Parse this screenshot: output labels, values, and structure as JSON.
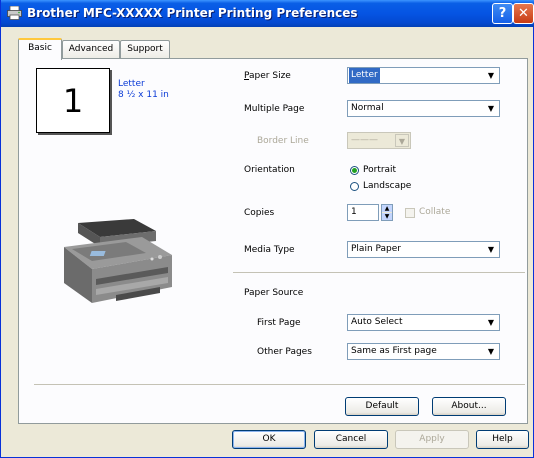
{
  "window": {
    "title": "Brother MFC-XXXXX Printer Printing Preferences",
    "help_glyph": "?",
    "close_glyph": "✕",
    "icon": "printer-icon"
  },
  "tabs": [
    {
      "label": "Basic",
      "active": true
    },
    {
      "label": "Advanced",
      "active": false
    },
    {
      "label": "Support",
      "active": false
    }
  ],
  "preview": {
    "page_number": "1",
    "paper_name": "Letter",
    "paper_dims": "8 ½ x 11 in",
    "device_image": "printer-device-illustration"
  },
  "form": {
    "paper_size": {
      "label": "Paper Size",
      "value": "Letter"
    },
    "multiple_page": {
      "label": "Multiple Page",
      "value": "Normal"
    },
    "border_line": {
      "label": "Border Line",
      "value": "———",
      "enabled": false
    },
    "orientation": {
      "label": "Orientation",
      "options": [
        "Portrait",
        "Landscape"
      ],
      "selected": "Portrait"
    },
    "copies": {
      "label": "Copies",
      "value": "1",
      "collate_label": "Collate",
      "collate_checked": false,
      "collate_enabled": false
    },
    "media_type": {
      "label": "Media Type",
      "value": "Plain Paper"
    },
    "paper_source": {
      "label": "Paper Source",
      "first_page": {
        "label": "First Page",
        "value": "Auto Select"
      },
      "other_pages": {
        "label": "Other Pages",
        "value": "Same as First page"
      }
    }
  },
  "panel_buttons": {
    "default": "Default",
    "about": "About..."
  },
  "dialog_buttons": {
    "ok": "OK",
    "cancel": "Cancel",
    "apply": "Apply",
    "help": "Help"
  },
  "colors": {
    "titlebar": "#0554e3",
    "selection": "#316ac5",
    "tab_highlight": "#ffc83c",
    "preview_text": "#0b3bd6",
    "radio_dot": "#21a121"
  }
}
